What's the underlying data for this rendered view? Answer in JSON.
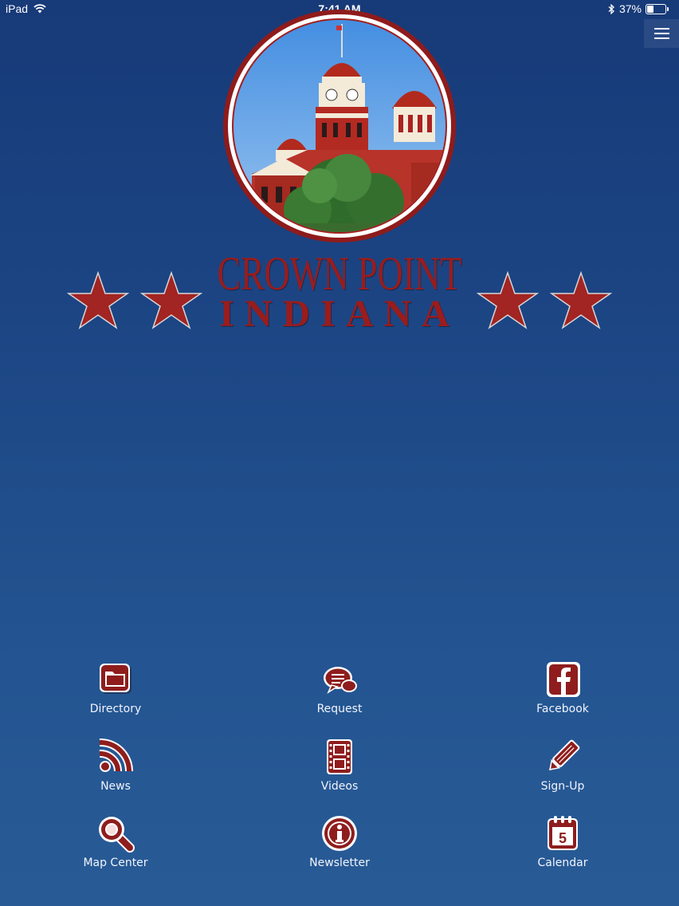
{
  "status_bar": {
    "device": "iPad",
    "time": "7:41 AM",
    "battery": "37%",
    "battery_level": 0.37,
    "icons": [
      "wifi-icon",
      "bluetooth-icon",
      "battery-icon"
    ]
  },
  "header": {
    "menu_icon": "hamburger-menu-icon"
  },
  "logo": {
    "title_line1": "CROWN POINT",
    "title_line2": "INDIANA",
    "image": "courthouse-photo",
    "brand_red": "#9a1c1c"
  },
  "menu": {
    "items": [
      {
        "label": "Directory",
        "icon": "folder-icon"
      },
      {
        "label": "Request",
        "icon": "chat-bubbles-icon"
      },
      {
        "label": "Facebook",
        "icon": "facebook-icon"
      },
      {
        "label": "News",
        "icon": "rss-icon"
      },
      {
        "label": "Videos",
        "icon": "film-icon"
      },
      {
        "label": "Sign-Up",
        "icon": "pencil-icon"
      },
      {
        "label": "Map Center",
        "icon": "magnifier-icon"
      },
      {
        "label": "Newsletter",
        "icon": "info-icon"
      },
      {
        "label": "Calendar",
        "icon": "calendar-icon",
        "badge": "5"
      }
    ]
  },
  "colors": {
    "background_top": "#173a78",
    "background_bottom": "#285b96",
    "icon_red": "#8f1d1d"
  }
}
